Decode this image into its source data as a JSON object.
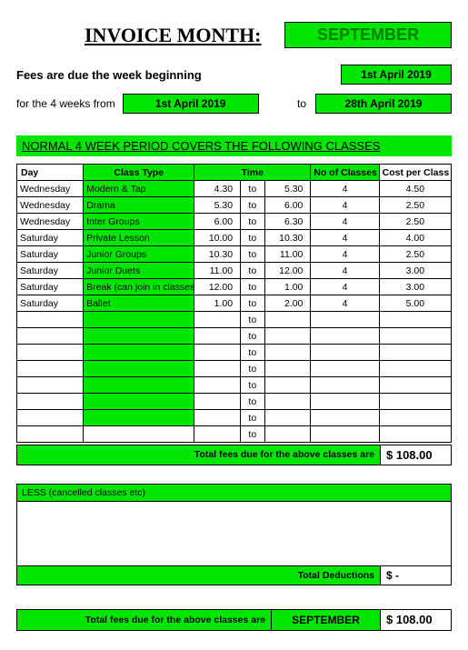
{
  "header": {
    "title": "INVOICE MONTH:",
    "month": "SEPTEMBER"
  },
  "due": {
    "text": "Fees are due the week beginning",
    "date": "1st April 2019"
  },
  "range": {
    "label": "for the 4 weeks from",
    "from": "1st April 2019",
    "to_label": "to",
    "to": "28th April 2019"
  },
  "section_banner": "NORMAL 4 WEEK PERIOD COVERS THE FOLLOWING CLASSES",
  "columns": {
    "day": "Day",
    "type": "Class Type",
    "time": "Time",
    "num": "No of Classes",
    "cost": "Cost per Class"
  },
  "rows": [
    {
      "day": "Wednesday",
      "type": "Modern & Tap",
      "from": "4.30",
      "to": "5.30",
      "num": "4",
      "cost": "4.50"
    },
    {
      "day": "Wednesday",
      "type": "Drama",
      "from": "5.30",
      "to": "6.00",
      "num": "4",
      "cost": "2.50"
    },
    {
      "day": "Wednesday",
      "type": "Inter Groups",
      "from": "6.00",
      "to": "6.30",
      "num": "4",
      "cost": "2.50"
    },
    {
      "day": "Saturday",
      "type": "Private Lesson",
      "from": "10.00",
      "to": "10.30",
      "num": "4",
      "cost": "4.00"
    },
    {
      "day": "Saturday",
      "type": "Junior Groups",
      "from": "10.30",
      "to": "11.00",
      "num": "4",
      "cost": "2.50"
    },
    {
      "day": "Saturday",
      "type": "Junior Duets",
      "from": "11.00",
      "to": "12.00",
      "num": "4",
      "cost": "3.00"
    },
    {
      "day": "Saturday",
      "type": "Break (can join in classes)",
      "from": "12.00",
      "to": "1.00",
      "num": "4",
      "cost": "3.00"
    },
    {
      "day": "Saturday",
      "type": "Ballet",
      "from": "1.00",
      "to": "2.00",
      "num": "4",
      "cost": "5.00"
    },
    {
      "day": "",
      "type": "",
      "from": "",
      "to": "",
      "num": "",
      "cost": ""
    },
    {
      "day": "",
      "type": "",
      "from": "",
      "to": "",
      "num": "",
      "cost": ""
    },
    {
      "day": "",
      "type": "",
      "from": "",
      "to": "",
      "num": "",
      "cost": ""
    },
    {
      "day": "",
      "type": "",
      "from": "",
      "to": "",
      "num": "",
      "cost": ""
    },
    {
      "day": "",
      "type": "",
      "from": "",
      "to": "",
      "num": "",
      "cost": ""
    },
    {
      "day": "",
      "type": "",
      "from": "",
      "to": "",
      "num": "",
      "cost": ""
    },
    {
      "day": "",
      "type": "",
      "from": "",
      "to": "",
      "num": "",
      "cost": ""
    },
    {
      "day": "",
      "type": "",
      "from": "",
      "to": "",
      "num": "",
      "cost": ""
    }
  ],
  "to_word": "to",
  "totals": {
    "classes_label": "Total fees due for the above classes are",
    "classes_value": "$ 108.00"
  },
  "less": {
    "header": "LESS (cancelled classes etc)",
    "footer_label": "Total Deductions",
    "footer_value": "$     -"
  },
  "final": {
    "label": "Total fees due for the above classes are",
    "month": "SEPTEMBER",
    "value": "$ 108.00"
  }
}
